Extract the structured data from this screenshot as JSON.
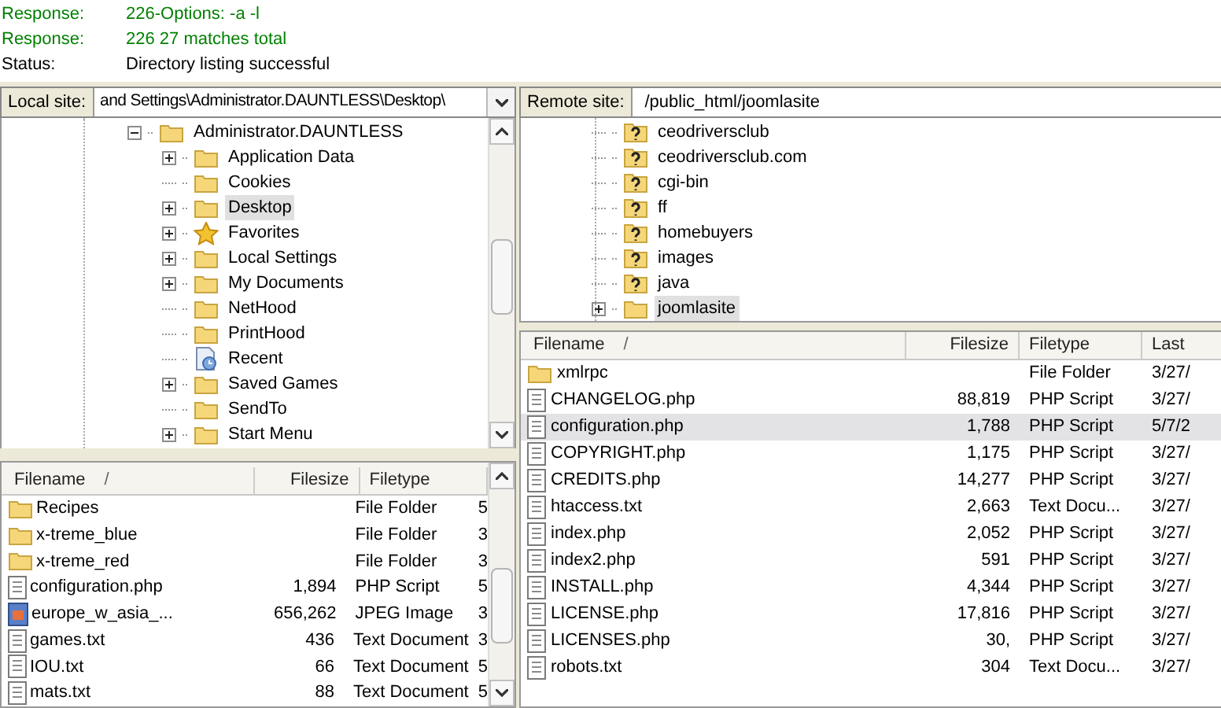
{
  "log": [
    {
      "label": "Response:",
      "text": "226-Options: -a -l",
      "kind": "response"
    },
    {
      "label": "Response:",
      "text": "226 27 matches total",
      "kind": "response"
    },
    {
      "label": "Status:",
      "text": "Directory listing successful",
      "kind": "status"
    }
  ],
  "local": {
    "label": "Local site:",
    "path": "and Settings\\Administrator.DAUNTLESS\\Desktop\\",
    "tree": [
      {
        "name": "Administrator.DAUNTLESS",
        "kind": "folder",
        "expanded": true,
        "selected": false,
        "children": [
          {
            "name": "Application Data",
            "kind": "folder",
            "expanded": false,
            "selected": false
          },
          {
            "name": "Cookies",
            "kind": "folder",
            "selected": false
          },
          {
            "name": "Desktop",
            "kind": "folder",
            "expanded": false,
            "selected": true
          },
          {
            "name": "Favorites",
            "kind": "star",
            "expanded": false,
            "selected": false
          },
          {
            "name": "Local Settings",
            "kind": "folder",
            "expanded": false,
            "selected": false
          },
          {
            "name": "My Documents",
            "kind": "folder",
            "expanded": false,
            "selected": false
          },
          {
            "name": "NetHood",
            "kind": "folder",
            "selected": false
          },
          {
            "name": "PrintHood",
            "kind": "folder",
            "selected": false
          },
          {
            "name": "Recent",
            "kind": "recent",
            "selected": false
          },
          {
            "name": "Saved Games",
            "kind": "folder",
            "expanded": false,
            "selected": false
          },
          {
            "name": "SendTo",
            "kind": "folder",
            "selected": false
          },
          {
            "name": "Start Menu",
            "kind": "folder",
            "expanded": false,
            "selected": false
          }
        ]
      }
    ],
    "columns": [
      "Filename",
      "/",
      "Filesize",
      "Filetype"
    ],
    "files": [
      {
        "name": "Recipes",
        "kind": "folder",
        "type": "File Folder",
        "column_4": "5",
        "selected": false
      },
      {
        "name": "x-treme_blue",
        "kind": "folder",
        "type": "File Folder",
        "column_4": "3",
        "selected": false
      },
      {
        "name": "x-treme_red",
        "kind": "folder",
        "type": "File Folder",
        "column_4": "3",
        "selected": false
      },
      {
        "name": "configuration.php",
        "kind": "file",
        "size": "1,894",
        "type": "PHP Script",
        "column_4": "5",
        "selected": false
      },
      {
        "name": "europe_w_asia_...",
        "kind": "image",
        "size": "656,262",
        "type": "JPEG Image",
        "column_4": "3",
        "selected": false
      },
      {
        "name": "games.txt",
        "kind": "file",
        "size": "436",
        "type": "Text Document",
        "column_4": "3",
        "selected": false
      },
      {
        "name": "IOU.txt",
        "kind": "file",
        "size": "66",
        "type": "Text Document",
        "column_4": "5",
        "selected": false
      },
      {
        "name": "mats.txt",
        "kind": "file",
        "size": "88",
        "type": "Text Document",
        "column_4": "5",
        "selected": false
      }
    ]
  },
  "remote": {
    "label": "Remote site:",
    "path": "/public_html/joomlasite",
    "tree": [
      {
        "name": "ceodriversclub",
        "kind": "unknown",
        "selected": false
      },
      {
        "name": "ceodriversclub.com",
        "kind": "unknown",
        "selected": false
      },
      {
        "name": "cgi-bin",
        "kind": "unknown",
        "selected": false
      },
      {
        "name": "ff",
        "kind": "unknown",
        "selected": false
      },
      {
        "name": "homebuyers",
        "kind": "unknown",
        "selected": false
      },
      {
        "name": "images",
        "kind": "unknown",
        "selected": false
      },
      {
        "name": "java",
        "kind": "unknown",
        "selected": false
      },
      {
        "name": "joomlasite",
        "kind": "folder",
        "expanded": false,
        "selected": true
      }
    ],
    "columns": [
      "Filename",
      "/",
      "Filesize",
      "Filetype",
      "Last"
    ],
    "files": [
      {
        "name": "xmlrpc",
        "kind": "folder",
        "type": "File Folder",
        "modified": "3/27/",
        "selected": false
      },
      {
        "name": "CHANGELOG.php",
        "kind": "file",
        "size": "88,819",
        "type": "PHP Script",
        "modified": "3/27/",
        "selected": false
      },
      {
        "name": "configuration.php",
        "kind": "file",
        "size": "1,788",
        "type": "PHP Script",
        "modified": "5/7/2",
        "selected": true
      },
      {
        "name": "COPYRIGHT.php",
        "kind": "file",
        "size": "1,175",
        "type": "PHP Script",
        "modified": "3/27/",
        "selected": false
      },
      {
        "name": "CREDITS.php",
        "kind": "file",
        "size": "14,277",
        "type": "PHP Script",
        "modified": "3/27/",
        "selected": false
      },
      {
        "name": "htaccess.txt",
        "kind": "file",
        "size": "2,663",
        "type": "Text Docu...",
        "modified": "3/27/",
        "selected": false
      },
      {
        "name": "index.php",
        "kind": "file",
        "size": "2,052",
        "type": "PHP Script",
        "modified": "3/27/",
        "selected": false
      },
      {
        "name": "index2.php",
        "kind": "file",
        "size": "591",
        "type": "PHP Script",
        "modified": "3/27/",
        "selected": false
      },
      {
        "name": "INSTALL.php",
        "kind": "file",
        "size": "4,344",
        "type": "PHP Script",
        "modified": "3/27/",
        "selected": false
      },
      {
        "name": "LICENSE.php",
        "kind": "file",
        "size": "17,816",
        "type": "PHP Script",
        "modified": "3/27/",
        "selected": false
      },
      {
        "name": "LICENSES.php",
        "kind": "file",
        "size": "30,",
        "type": "PHP Script",
        "modified": "3/27/",
        "selected": false
      },
      {
        "name": "robots.txt",
        "kind": "file",
        "size": "304",
        "type": "Text Docu...",
        "modified": "3/27/",
        "selected": false
      }
    ]
  }
}
